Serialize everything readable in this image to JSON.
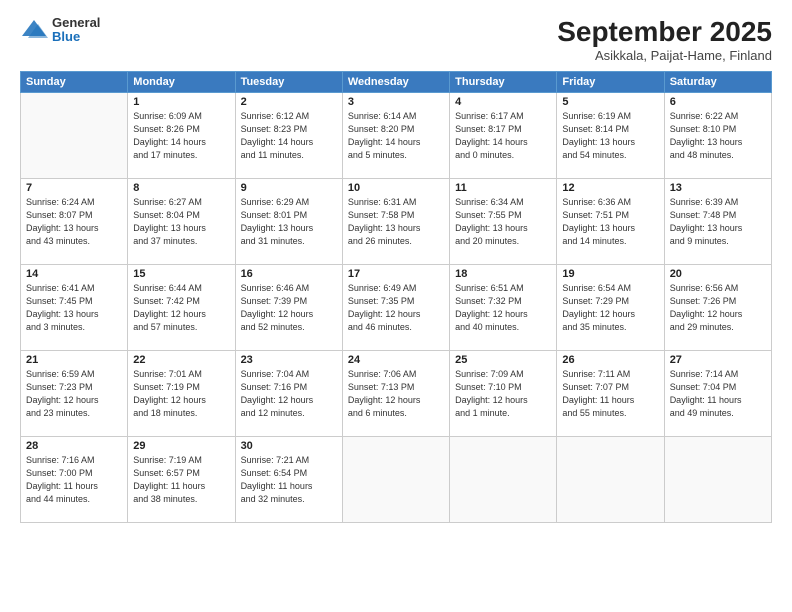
{
  "header": {
    "logo_general": "General",
    "logo_blue": "Blue",
    "month_title": "September 2025",
    "location": "Asikkala, Paijat-Hame, Finland"
  },
  "days_of_week": [
    "Sunday",
    "Monday",
    "Tuesday",
    "Wednesday",
    "Thursday",
    "Friday",
    "Saturday"
  ],
  "weeks": [
    [
      {
        "day": "",
        "text": ""
      },
      {
        "day": "1",
        "text": "Sunrise: 6:09 AM\nSunset: 8:26 PM\nDaylight: 14 hours\nand 17 minutes."
      },
      {
        "day": "2",
        "text": "Sunrise: 6:12 AM\nSunset: 8:23 PM\nDaylight: 14 hours\nand 11 minutes."
      },
      {
        "day": "3",
        "text": "Sunrise: 6:14 AM\nSunset: 8:20 PM\nDaylight: 14 hours\nand 5 minutes."
      },
      {
        "day": "4",
        "text": "Sunrise: 6:17 AM\nSunset: 8:17 PM\nDaylight: 14 hours\nand 0 minutes."
      },
      {
        "day": "5",
        "text": "Sunrise: 6:19 AM\nSunset: 8:14 PM\nDaylight: 13 hours\nand 54 minutes."
      },
      {
        "day": "6",
        "text": "Sunrise: 6:22 AM\nSunset: 8:10 PM\nDaylight: 13 hours\nand 48 minutes."
      }
    ],
    [
      {
        "day": "7",
        "text": "Sunrise: 6:24 AM\nSunset: 8:07 PM\nDaylight: 13 hours\nand 43 minutes."
      },
      {
        "day": "8",
        "text": "Sunrise: 6:27 AM\nSunset: 8:04 PM\nDaylight: 13 hours\nand 37 minutes."
      },
      {
        "day": "9",
        "text": "Sunrise: 6:29 AM\nSunset: 8:01 PM\nDaylight: 13 hours\nand 31 minutes."
      },
      {
        "day": "10",
        "text": "Sunrise: 6:31 AM\nSunset: 7:58 PM\nDaylight: 13 hours\nand 26 minutes."
      },
      {
        "day": "11",
        "text": "Sunrise: 6:34 AM\nSunset: 7:55 PM\nDaylight: 13 hours\nand 20 minutes."
      },
      {
        "day": "12",
        "text": "Sunrise: 6:36 AM\nSunset: 7:51 PM\nDaylight: 13 hours\nand 14 minutes."
      },
      {
        "day": "13",
        "text": "Sunrise: 6:39 AM\nSunset: 7:48 PM\nDaylight: 13 hours\nand 9 minutes."
      }
    ],
    [
      {
        "day": "14",
        "text": "Sunrise: 6:41 AM\nSunset: 7:45 PM\nDaylight: 13 hours\nand 3 minutes."
      },
      {
        "day": "15",
        "text": "Sunrise: 6:44 AM\nSunset: 7:42 PM\nDaylight: 12 hours\nand 57 minutes."
      },
      {
        "day": "16",
        "text": "Sunrise: 6:46 AM\nSunset: 7:39 PM\nDaylight: 12 hours\nand 52 minutes."
      },
      {
        "day": "17",
        "text": "Sunrise: 6:49 AM\nSunset: 7:35 PM\nDaylight: 12 hours\nand 46 minutes."
      },
      {
        "day": "18",
        "text": "Sunrise: 6:51 AM\nSunset: 7:32 PM\nDaylight: 12 hours\nand 40 minutes."
      },
      {
        "day": "19",
        "text": "Sunrise: 6:54 AM\nSunset: 7:29 PM\nDaylight: 12 hours\nand 35 minutes."
      },
      {
        "day": "20",
        "text": "Sunrise: 6:56 AM\nSunset: 7:26 PM\nDaylight: 12 hours\nand 29 minutes."
      }
    ],
    [
      {
        "day": "21",
        "text": "Sunrise: 6:59 AM\nSunset: 7:23 PM\nDaylight: 12 hours\nand 23 minutes."
      },
      {
        "day": "22",
        "text": "Sunrise: 7:01 AM\nSunset: 7:19 PM\nDaylight: 12 hours\nand 18 minutes."
      },
      {
        "day": "23",
        "text": "Sunrise: 7:04 AM\nSunset: 7:16 PM\nDaylight: 12 hours\nand 12 minutes."
      },
      {
        "day": "24",
        "text": "Sunrise: 7:06 AM\nSunset: 7:13 PM\nDaylight: 12 hours\nand 6 minutes."
      },
      {
        "day": "25",
        "text": "Sunrise: 7:09 AM\nSunset: 7:10 PM\nDaylight: 12 hours\nand 1 minute."
      },
      {
        "day": "26",
        "text": "Sunrise: 7:11 AM\nSunset: 7:07 PM\nDaylight: 11 hours\nand 55 minutes."
      },
      {
        "day": "27",
        "text": "Sunrise: 7:14 AM\nSunset: 7:04 PM\nDaylight: 11 hours\nand 49 minutes."
      }
    ],
    [
      {
        "day": "28",
        "text": "Sunrise: 7:16 AM\nSunset: 7:00 PM\nDaylight: 11 hours\nand 44 minutes."
      },
      {
        "day": "29",
        "text": "Sunrise: 7:19 AM\nSunset: 6:57 PM\nDaylight: 11 hours\nand 38 minutes."
      },
      {
        "day": "30",
        "text": "Sunrise: 7:21 AM\nSunset: 6:54 PM\nDaylight: 11 hours\nand 32 minutes."
      },
      {
        "day": "",
        "text": ""
      },
      {
        "day": "",
        "text": ""
      },
      {
        "day": "",
        "text": ""
      },
      {
        "day": "",
        "text": ""
      }
    ]
  ]
}
